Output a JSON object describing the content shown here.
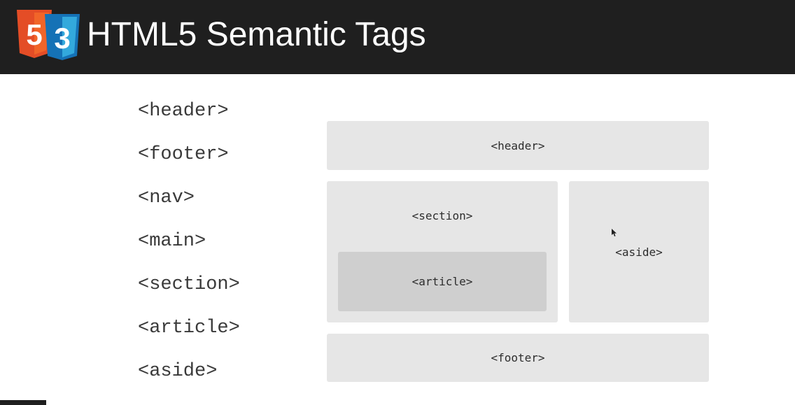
{
  "title": "HTML5 Semantic Tags",
  "logos": [
    {
      "name": "html5-logo",
      "label": "5",
      "color": "#e44d26"
    },
    {
      "name": "css3-logo",
      "label": "3",
      "color": "#1572b6"
    }
  ],
  "tag_list": [
    "<header>",
    "<footer>",
    "<nav>",
    "<main>",
    "<section>",
    "<article>",
    "<aside>"
  ],
  "layout": {
    "header": "<header>",
    "section": "<section>",
    "article": "<article>",
    "aside": "<aside>",
    "footer": "<footer>"
  }
}
